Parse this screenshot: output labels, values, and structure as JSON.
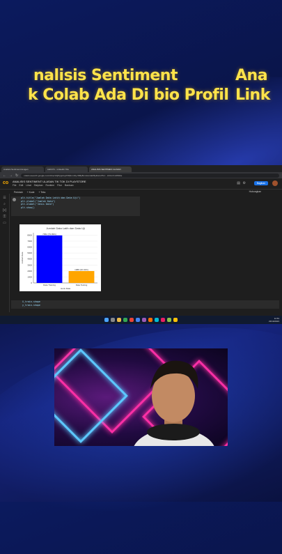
{
  "headlines": {
    "line1": "nalisis Sentiment",
    "line2": "k Colab Ada Di bio Profil",
    "line1_right": "Ana",
    "line2_right": "Link"
  },
  "browser": {
    "tabs": [
      "Analisis Sentiment dengan",
      "LEKAT1 - Linkedin 'Kla",
      "ANALISIS SENTIMEN ULASAN"
    ],
    "url": "colab.research.google.com/drive/1tQPjrgLfoytlXPjKnmDy-WBp8nmtxk-ldaN5y#scrollTo=.../c0Uo7cx0PkDe"
  },
  "colab": {
    "notebook_title": "ANALISIS SENTIMENT ULASAN TIK TOK DI PLAYSTORE",
    "menu": [
      "File",
      "Edit",
      "Lihat",
      "Sisipkan",
      "Runtime",
      "Fitur",
      "Bantuan"
    ],
    "share_label": "Bagikan",
    "toolbar": [
      "Perintah",
      "+ Kode",
      "+ Teks"
    ],
    "runtime_label": "Hubungkan",
    "code_lines": [
      "plt.title(\"Jumlah Data Latih dan Data Uji\")",
      "plt.ylabel(\"Jumlah Data\")",
      "plt.xlabel(\"Jenis Data\")",
      "plt.show()"
    ],
    "next_cell_lines": [
      "X_train.shape",
      "y_train.shape"
    ]
  },
  "chart_data": {
    "type": "bar",
    "title": "Jumlah Data Latih dan Data Uji",
    "xlabel": "Jenis Data",
    "ylabel": "Jumlah Data",
    "categories": [
      "Data Training",
      "Data Testing"
    ],
    "values": [
      7952,
      1988
    ],
    "data_labels": [
      "7952 (79.99%)",
      "1988 (20.01%)"
    ],
    "colors": [
      "#0000ff",
      "#ffa500"
    ],
    "yticks": [
      0,
      1000,
      2000,
      3000,
      4000,
      5000,
      6000,
      7000,
      8000
    ],
    "ylim": [
      0,
      8400
    ]
  },
  "taskbar": {
    "time": "11:53",
    "date": "23/10/2023"
  },
  "colors": {
    "headline": "#ffe34a",
    "share": "#1a73e8"
  }
}
